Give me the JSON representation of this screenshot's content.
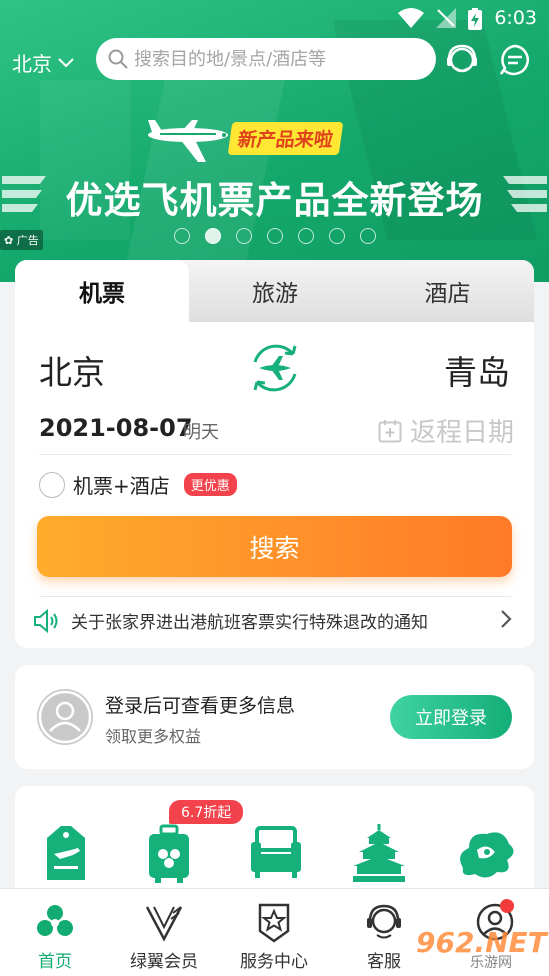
{
  "status_bar": {
    "time": "6:03"
  },
  "header": {
    "city": "北京",
    "search_placeholder": "搜索目的地/景点/酒店等"
  },
  "banner": {
    "badge": "新产品来啦",
    "headline": "优选飞机票产品全新登场",
    "ad_label": "广告",
    "dots_count": 7,
    "active_dot": 2
  },
  "booking": {
    "tabs": [
      "机票",
      "旅游",
      "酒店"
    ],
    "active_tab": 0,
    "from_city": "北京",
    "to_city": "青岛",
    "depart_date": "2021-08-07",
    "depart_day": "明天",
    "return_placeholder": "返程日期",
    "combo_label": "机票+酒店",
    "combo_badge": "更优惠",
    "search_label": "搜索",
    "notice": "关于张家界进出港航班客票实行特殊退改的通知"
  },
  "login": {
    "title": "登录后可查看更多信息",
    "subtitle": "领取更多权益",
    "button": "立即登录"
  },
  "services": {
    "discount_badge": "6.7折起"
  },
  "bottom_nav": {
    "items": [
      "首页",
      "绿翼会员",
      "服务中心",
      "客服",
      ""
    ],
    "active": 0
  },
  "watermark": {
    "main": "962.NET",
    "sub": "乐游网"
  },
  "colors": {
    "brand_green": "#13ab72",
    "search_orange": "#ff8a28",
    "badge_red": "#f2434c"
  }
}
